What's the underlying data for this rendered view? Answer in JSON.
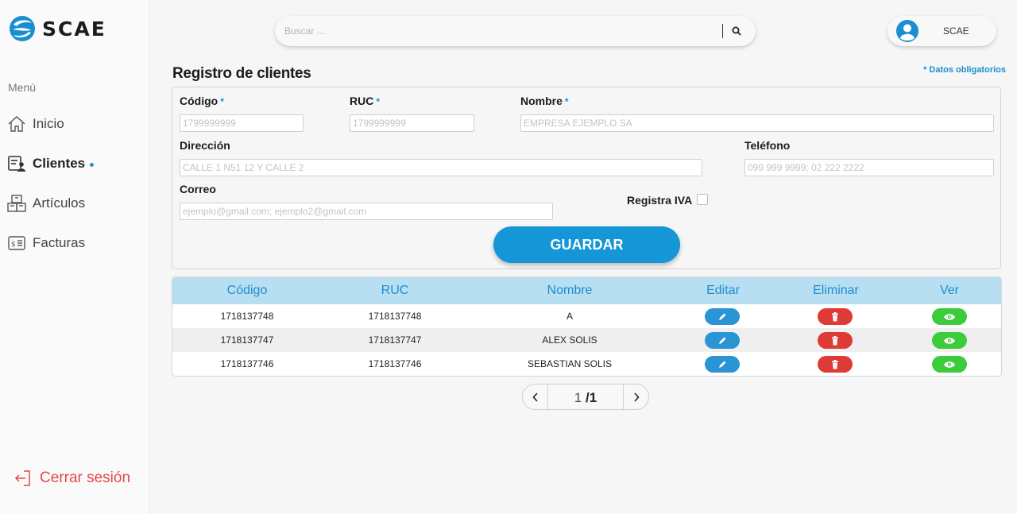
{
  "app": {
    "name": "SCAE",
    "menu_label": "Menú"
  },
  "sidebar": {
    "items": [
      {
        "label": "Inicio",
        "icon": "home-icon"
      },
      {
        "label": "Clientes",
        "icon": "clients-icon",
        "active": true
      },
      {
        "label": "Artículos",
        "icon": "boxes-icon"
      },
      {
        "label": "Facturas",
        "icon": "invoice-icon"
      }
    ],
    "logout_label": "Cerrar sesión"
  },
  "search": {
    "placeholder": "Buscar ...",
    "value": ""
  },
  "user": {
    "name": "SCAE"
  },
  "form": {
    "title": "Registro de clientes",
    "required_note": "* Datos obligatorios",
    "required_mark": "*",
    "codigo": {
      "label": "Código",
      "placeholder": "1799999999",
      "value": ""
    },
    "ruc": {
      "label": "RUC",
      "placeholder": "1799999999",
      "value": ""
    },
    "nombre": {
      "label": "Nombre",
      "placeholder": "EMPRESA EJEMPLO SA",
      "value": ""
    },
    "direccion": {
      "label": "Dirección",
      "placeholder": "CALLE 1 N51 12 Y CALLE 2",
      "value": ""
    },
    "telefono": {
      "label": "Teléfono",
      "placeholder": "099 999 9999; 02 222 2222",
      "value": ""
    },
    "correo": {
      "label": "Correo",
      "placeholder": "ejemplo@gmail.com; ejemplo2@gmail.com",
      "value": ""
    },
    "registra_iva": {
      "label": "Registra IVA",
      "checked": false
    },
    "save_label": "GUARDAR"
  },
  "table": {
    "headers": {
      "codigo": "Código",
      "ruc": "RUC",
      "nombre": "Nombre",
      "editar": "Editar",
      "eliminar": "Eliminar",
      "ver": "Ver"
    },
    "rows": [
      {
        "codigo": "1718137748",
        "ruc": "1718137748",
        "nombre": "A"
      },
      {
        "codigo": "1718137747",
        "ruc": "1718137747",
        "nombre": "ALEX SOLIS"
      },
      {
        "codigo": "1718137746",
        "ruc": "1718137746",
        "nombre": "SEBASTIAN SOLIS"
      }
    ]
  },
  "pagination": {
    "current": "1",
    "separator": "/",
    "total": "1"
  },
  "colors": {
    "accent": "#1596d7",
    "header_bg": "#b8def2",
    "edit": "#2a94d4",
    "delete": "#df3b36",
    "view": "#3bcb3b",
    "logout": "#e5484d"
  }
}
